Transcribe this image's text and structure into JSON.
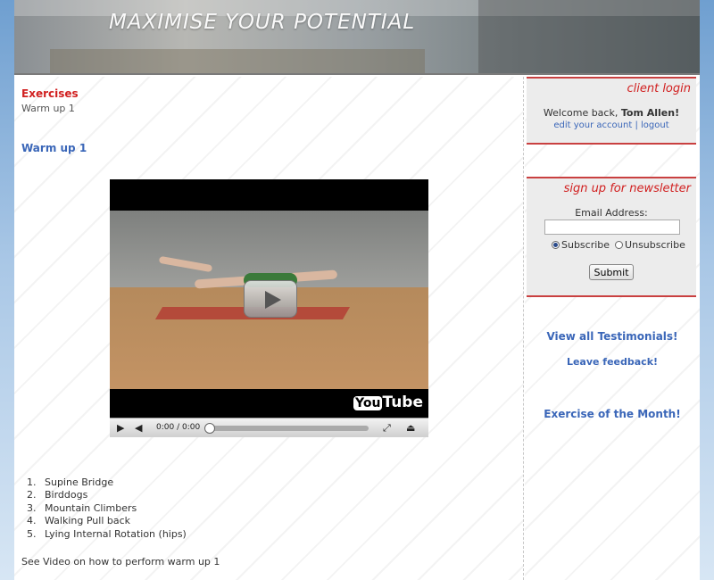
{
  "banner": {
    "title": "MAXIMISE YOUR POTENTIAL"
  },
  "main": {
    "section_heading": "Exercises",
    "breadcrumb": "Warm up 1",
    "page_title": "Warm up 1",
    "video": {
      "time": "0:00 / 0:00",
      "brand": "You",
      "brand_tube": "Tube"
    },
    "exercises": [
      "Supine Bridge",
      "Birddogs",
      "Mountain Climbers",
      "Walking Pull back",
      "Lying Internal Rotation (hips)"
    ],
    "numbers": [
      "1.",
      "2.",
      "3.",
      "4.",
      "5."
    ],
    "see_video": "See Video on how to perform warm up 1"
  },
  "sidebar": {
    "login": {
      "title": "client login",
      "welcome_prefix": "Welcome back, ",
      "user_name": "Tom Allen!",
      "edit_link": "edit your account",
      "separator": "|",
      "logout_link": "logout"
    },
    "newsletter": {
      "title": "sign up for newsletter",
      "email_label": "Email Address:",
      "email_value": "",
      "subscribe": "Subscribe",
      "unsubscribe": "Unsubscribe",
      "submit": "Submit"
    },
    "links": {
      "testimonials": "View all Testimonials!",
      "feedback": "Leave feedback!",
      "exercise_month": "Exercise of the Month!"
    }
  },
  "colors": {
    "accent_red": "#d12020",
    "link_blue": "#3a66b8"
  },
  "icons": [
    "play-icon",
    "volume-icon",
    "fullscreen-icon",
    "expand-icon"
  ]
}
